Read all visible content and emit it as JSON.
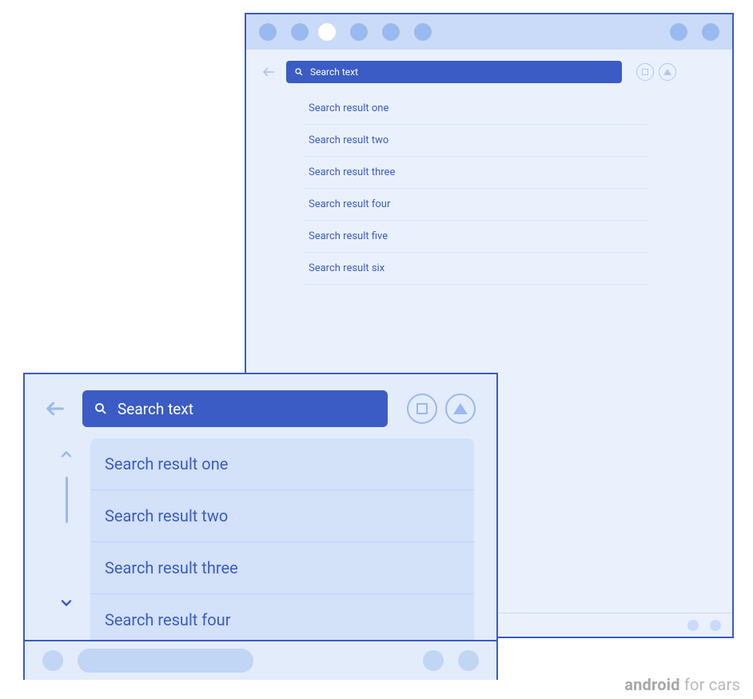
{
  "search": {
    "placeholder": "Search text"
  },
  "large_window": {
    "results": [
      "Search result one",
      "Search result two",
      "Search result three",
      "Search result four",
      "Search result five",
      "Search result six"
    ]
  },
  "small_window": {
    "results": [
      "Search result one",
      "Search result two",
      "Search result three",
      "Search result four"
    ]
  },
  "watermark": {
    "brand": "android",
    "suffix": " for cars"
  }
}
